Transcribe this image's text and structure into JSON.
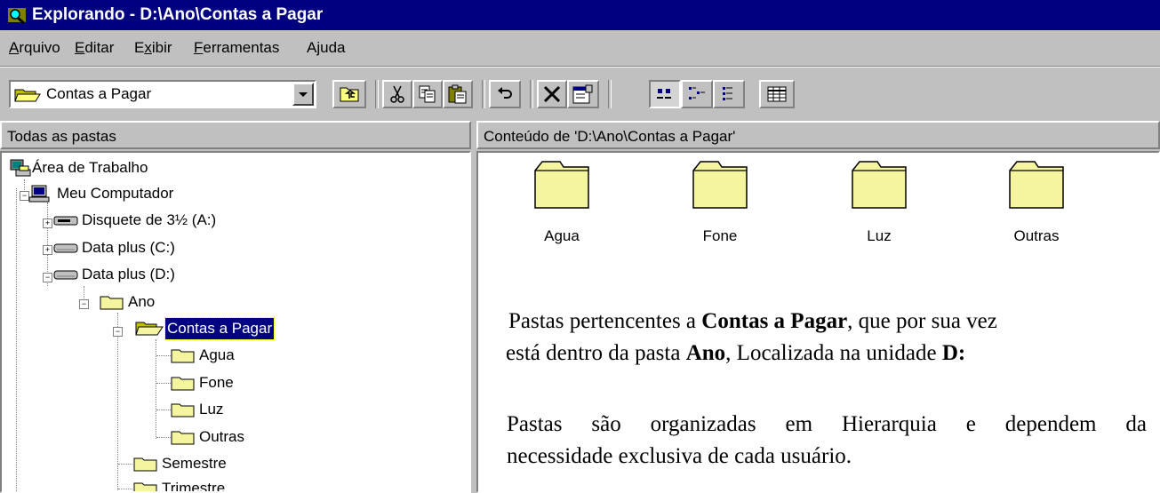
{
  "window": {
    "title": "Explorando - D:\\Ano\\Contas a Pagar",
    "icon": "explorer-icon"
  },
  "menu": {
    "items": [
      {
        "label": "Arquivo",
        "mnemonic": "A",
        "rest": "rquivo"
      },
      {
        "label": "Editar",
        "mnemonic": "E",
        "rest": "ditar"
      },
      {
        "label": "Exibir",
        "pre": "E",
        "mnemonic": "x",
        "rest": "ibir"
      },
      {
        "label": "Ferramentas",
        "mnemonic": "F",
        "rest": "erramentas"
      },
      {
        "label": "Ajuda",
        "pre": "A",
        "mnemonic": "j",
        "rest": "uda"
      }
    ]
  },
  "toolbar": {
    "location": "Contas a Pagar",
    "buttons": [
      "up-one-level-icon",
      "cut-icon",
      "copy-icon",
      "paste-icon",
      "undo-icon",
      "delete-icon",
      "properties-icon",
      "large-icons-icon",
      "small-icons-icon",
      "list-icon",
      "details-icon"
    ]
  },
  "left_pane": {
    "header": "Todas as pastas",
    "tree": [
      {
        "label": "Área de Trabalho",
        "icon": "desktop-icon"
      },
      {
        "label": "Meu Computador",
        "icon": "computer-icon"
      },
      {
        "label": "Disquete de 3½ (A:)",
        "icon": "floppy-drive-icon"
      },
      {
        "label": "Data plus (C:)",
        "icon": "hard-drive-icon"
      },
      {
        "label": "Data plus (D:)",
        "icon": "hard-drive-icon"
      },
      {
        "label": "Ano",
        "icon": "folder-icon"
      },
      {
        "label": "Contas a Pagar",
        "icon": "open-folder-icon",
        "selected": true
      },
      {
        "label": "Agua",
        "icon": "folder-icon"
      },
      {
        "label": "Fone",
        "icon": "folder-icon"
      },
      {
        "label": "Luz",
        "icon": "folder-icon"
      },
      {
        "label": "Outras",
        "icon": "folder-icon"
      },
      {
        "label": "Semestre",
        "icon": "folder-icon"
      },
      {
        "label": "Trimestre",
        "icon": "folder-icon"
      }
    ]
  },
  "right_pane": {
    "header": "Conteúdo de 'D:\\Ano\\Contas a Pagar'",
    "folders": [
      "Agua",
      "Fone",
      "Luz",
      "Outras"
    ]
  },
  "notes": {
    "p1": {
      "t1": "Pastas pertencentes a ",
      "b1": "Contas a Pagar",
      "t2": ", que por sua vez",
      "t3": "está dentro da pasta ",
      "b2": "Ano",
      "t4": ", Localizada na unidade ",
      "b3": "D:"
    },
    "p2": {
      "line1": "Pastas são organizadas em Hierarquia e dependem da",
      "line2": "necessidade exclusiva de cada usuário."
    }
  },
  "colors": {
    "titlebar": "#000080",
    "face": "#c0c0c0",
    "folder": "#f5f5a0",
    "selection": "#000080"
  }
}
